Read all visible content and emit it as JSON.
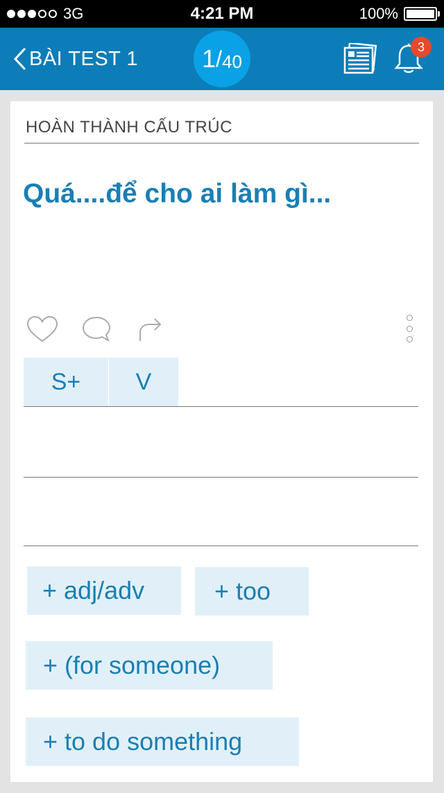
{
  "status_bar": {
    "carrier": "3G",
    "time": "4:21 PM",
    "battery": "100%"
  },
  "nav": {
    "back_title": "BÀI TEST 1",
    "current": "1",
    "separator": "/",
    "total": "40",
    "notification_count": "3",
    "color": "#0c7db8",
    "counter_color": "#0aa1e6"
  },
  "card": {
    "section_title": "HOÀN THÀNH CẤU TRÚC",
    "question": "Quá....để cho ai làm gì..."
  },
  "answer_slots": [
    "S+",
    "V"
  ],
  "options": [
    "+ adj/adv",
    "+ too",
    "+ (for someone)",
    "+ to do something"
  ],
  "icons": {
    "like": "heart-icon",
    "comment": "comment-icon",
    "share": "share-icon",
    "more": "more-vertical-icon",
    "flashcards": "flashcards-icon",
    "notifications": "bell-icon"
  },
  "colors": {
    "accent": "#1a7fb3",
    "chip_bg": "#e1f0f8",
    "badge": "#e8492a"
  }
}
